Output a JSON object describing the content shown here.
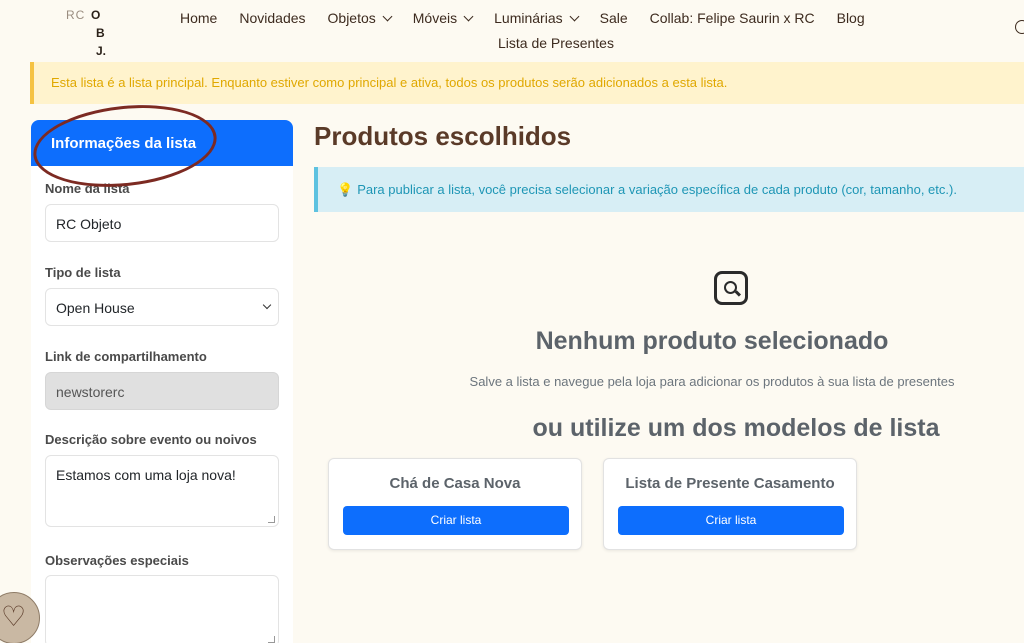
{
  "header": {
    "logo": {
      "rc": "RC",
      "o": "O",
      "b": "B",
      "j": "J."
    },
    "nav": [
      {
        "label": "Home",
        "dropdown": false
      },
      {
        "label": "Novidades",
        "dropdown": false
      },
      {
        "label": "Objetos",
        "dropdown": true
      },
      {
        "label": "Móveis",
        "dropdown": true
      },
      {
        "label": "Luminárias",
        "dropdown": true
      },
      {
        "label": "Sale",
        "dropdown": false
      },
      {
        "label": "Collab: Felipe Saurin x RC",
        "dropdown": false
      },
      {
        "label": "Blog",
        "dropdown": false
      }
    ],
    "nav_second_row": "Lista de Presentes",
    "search_icon": "search-icon"
  },
  "alert_main": "Esta lista é a lista principal. Enquanto estiver como principal e ativa, todos os produtos serão adicionados a esta lista.",
  "sidebar": {
    "header": "Informações da lista",
    "name_label": "Nome da lista",
    "name_value": "RC Objeto",
    "type_label": "Tipo de lista",
    "type_value": "Open House",
    "link_label": "Link de compartilhamento",
    "link_value": "newstorerc",
    "desc_label": "Descrição sobre evento ou noivos",
    "desc_value": "Estamos com uma loja nova!",
    "notes_label": "Observações especiais",
    "notes_value": ""
  },
  "main": {
    "title": "Produtos escolhidos",
    "info_alert": "Para publicar a lista, você precisa selecionar a variação específica de cada produto (cor, tamanho, etc.).",
    "info_icon": "lightbulb-icon",
    "empty_title": "Nenhum produto selecionado",
    "empty_desc": "Salve a lista e navegue pela loja para adicionar os produtos à sua lista de presentes",
    "models_title": "ou utilize um dos modelos de lista",
    "cards": [
      {
        "title": "Chá de Casa Nova",
        "button": "Criar lista"
      },
      {
        "title": "Lista de Presente Casamento",
        "button": "Criar lista"
      }
    ]
  },
  "colors": {
    "primary": "#0d6efd",
    "brown": "#5a3a28",
    "warning_bg": "#fff3cd",
    "info_bg": "#d7eef5",
    "annotation": "#7c2a22"
  }
}
